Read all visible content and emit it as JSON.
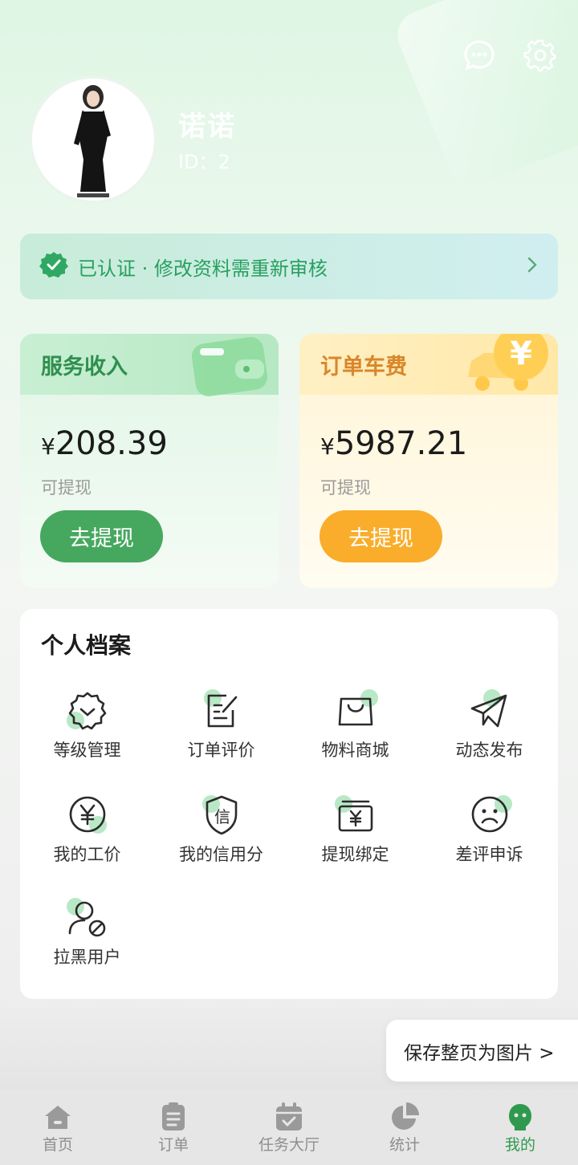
{
  "header": {
    "user_name": "诺诺",
    "user_id": "ID：2",
    "icons": [
      "message-icon",
      "settings-icon"
    ]
  },
  "verify": {
    "text": "已认证 · 修改资料需重新审核",
    "icon": "verified-badge-icon"
  },
  "income_cards": [
    {
      "title": "服务收入",
      "currency": "¥",
      "amount": "208.39",
      "sub": "可提现",
      "button": "去提现",
      "color": "#46a85f"
    },
    {
      "title": "订单车费",
      "currency": "¥",
      "amount": "5987.21",
      "sub": "可提现",
      "button": "去提现",
      "color": "#f9ad2a"
    }
  ],
  "profile": {
    "title": "个人档案",
    "items": [
      {
        "label": "等级管理",
        "icon": "level-badge-icon"
      },
      {
        "label": "订单评价",
        "icon": "review-edit-icon"
      },
      {
        "label": "物料商城",
        "icon": "shopping-bag-icon"
      },
      {
        "label": "动态发布",
        "icon": "paper-plane-icon"
      },
      {
        "label": "我的工价",
        "icon": "yen-circle-icon"
      },
      {
        "label": "我的信用分",
        "icon": "credit-shield-icon"
      },
      {
        "label": "提现绑定",
        "icon": "wallet-yen-icon"
      },
      {
        "label": "差评申诉",
        "icon": "sad-face-icon"
      },
      {
        "label": "拉黑用户",
        "icon": "block-user-icon"
      }
    ]
  },
  "save_float": "保存整页为图片 >",
  "tabbar": [
    {
      "label": "首页",
      "icon": "home-icon",
      "active": false
    },
    {
      "label": "订单",
      "icon": "clipboard-icon",
      "active": false
    },
    {
      "label": "任务大厅",
      "icon": "calendar-check-icon",
      "active": false
    },
    {
      "label": "统计",
      "icon": "pie-chart-icon",
      "active": false
    },
    {
      "label": "我的",
      "icon": "mine-avatar-icon",
      "active": true
    }
  ],
  "colors": {
    "accent_green": "#2f9a4d",
    "accent_orange": "#f9ad2a"
  }
}
